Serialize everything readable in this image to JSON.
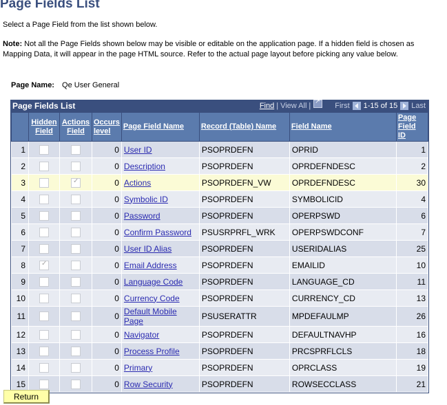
{
  "page_title": "Page Fields List",
  "intro": "Select a Page Field from the list shown below.",
  "note": {
    "label": "Note:",
    "text": " Not all the Page Fields shown below may be visible or editable on the application page. If a hidden field is chosen as Mapping Data, it will appear in the page HTML source. Refer to the actual page layout before picking any value below."
  },
  "page_name": {
    "label": "Page Name:",
    "value": "Qe User General"
  },
  "grid": {
    "title": "Page Fields List",
    "find": "Find",
    "view_all": "View All",
    "first": "First",
    "range": "1-15 of 15",
    "last": "Last",
    "columns": {
      "hidden": [
        "Hidden",
        "Field"
      ],
      "actions": [
        "Actions",
        "Field"
      ],
      "occurs": [
        "Occurs",
        "level"
      ],
      "page_field_name": "Page Field Name",
      "record_name": "Record (Table) Name",
      "field_name": "Field Name",
      "page_field_id": [
        "Page Field",
        "ID"
      ]
    },
    "rows": [
      {
        "n": "1",
        "hidden": false,
        "actions": false,
        "occurs": "0",
        "name": "User ID",
        "record": "PSOPRDEFN",
        "field": "OPRID",
        "id": "1"
      },
      {
        "n": "2",
        "hidden": false,
        "actions": false,
        "occurs": "0",
        "name": "Description",
        "record": "PSOPRDEFN",
        "field": "OPRDEFNDESC",
        "id": "2"
      },
      {
        "n": "3",
        "hidden": false,
        "actions": true,
        "occurs": "0",
        "name": "Actions",
        "record": "PSOPRDEFN_VW",
        "field": "OPRDEFNDESC",
        "id": "30",
        "highlight": true
      },
      {
        "n": "4",
        "hidden": false,
        "actions": false,
        "occurs": "0",
        "name": "Symbolic ID",
        "record": "PSOPRDEFN",
        "field": "SYMBOLICID",
        "id": "4"
      },
      {
        "n": "5",
        "hidden": false,
        "actions": false,
        "occurs": "0",
        "name": "Password",
        "record": "PSOPRDEFN",
        "field": "OPERPSWD",
        "id": "6"
      },
      {
        "n": "6",
        "hidden": false,
        "actions": false,
        "occurs": "0",
        "name": "Confirm Password",
        "record": "PSUSRPRFL_WRK",
        "field": "OPERPSWDCONF",
        "id": "7"
      },
      {
        "n": "7",
        "hidden": false,
        "actions": false,
        "occurs": "0",
        "name": "User ID Alias",
        "record": "PSOPRDEFN",
        "field": "USERIDALIAS",
        "id": "25"
      },
      {
        "n": "8",
        "hidden": true,
        "actions": false,
        "occurs": "0",
        "name": "Email Address",
        "record": "PSOPRDEFN",
        "field": "EMAILID",
        "id": "10"
      },
      {
        "n": "9",
        "hidden": false,
        "actions": false,
        "occurs": "0",
        "name": "Language Code",
        "record": "PSOPRDEFN",
        "field": "LANGUAGE_CD",
        "id": "11"
      },
      {
        "n": "10",
        "hidden": false,
        "actions": false,
        "occurs": "0",
        "name": "Currency Code",
        "record": "PSOPRDEFN",
        "field": "CURRENCY_CD",
        "id": "13"
      },
      {
        "n": "11",
        "hidden": false,
        "actions": false,
        "occurs": "0",
        "name": "Default Mobile Page",
        "record": "PSUSERATTR",
        "field": "MPDEFAULMP",
        "id": "26"
      },
      {
        "n": "12",
        "hidden": false,
        "actions": false,
        "occurs": "0",
        "name": "Navigator",
        "record": "PSOPRDEFN",
        "field": "DEFAULTNAVHP",
        "id": "16"
      },
      {
        "n": "13",
        "hidden": false,
        "actions": false,
        "occurs": "0",
        "name": "Process Profile",
        "record": "PSOPRDEFN",
        "field": "PRCSPRFLCLS",
        "id": "18"
      },
      {
        "n": "14",
        "hidden": false,
        "actions": false,
        "occurs": "0",
        "name": "Primary",
        "record": "PSOPRDEFN",
        "field": "OPRCLASS",
        "id": "19"
      },
      {
        "n": "15",
        "hidden": false,
        "actions": false,
        "occurs": "0",
        "name": "Row Security",
        "record": "PSOPRDEFN",
        "field": "ROWSECCLASS",
        "id": "21"
      }
    ]
  },
  "return_button": "Return"
}
